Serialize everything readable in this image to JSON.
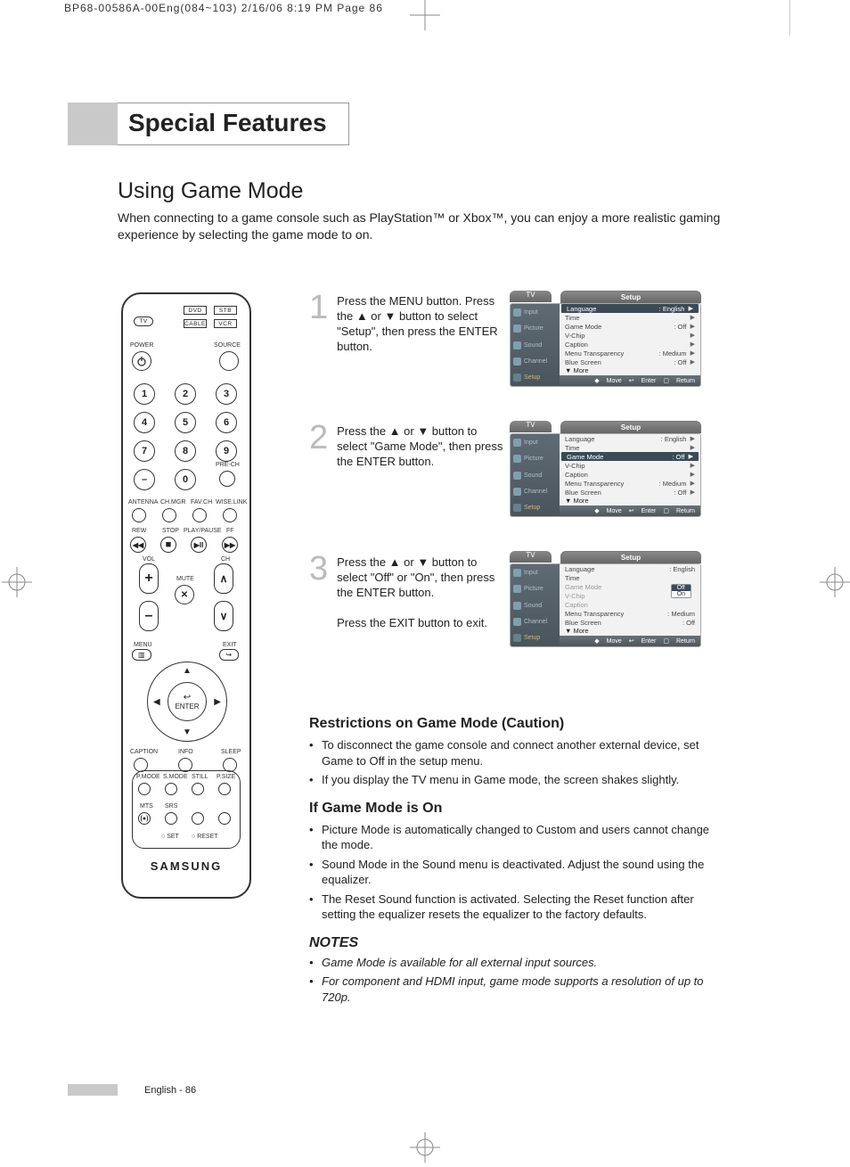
{
  "header_note": "BP68-00586A-00Eng(084~103)  2/16/06  8:19 PM  Page 86",
  "section_title": "Special Features",
  "subheading": "Using Game Mode",
  "intro": "When connecting to a game console such as PlayStation™ or Xbox™, you can enjoy a more realistic gaming experience by selecting the game mode to on.",
  "remote": {
    "tv": "TV",
    "dvd": "DVD",
    "stb": "STB",
    "cable": "CABLE",
    "vcr": "VCR",
    "power": "POWER",
    "source": "SOURCE",
    "nums": [
      "1",
      "2",
      "3",
      "4",
      "5",
      "6",
      "7",
      "8",
      "9",
      "0"
    ],
    "dash": "–",
    "prech": "PRE-CH",
    "ant": "ANTENNA",
    "chmgr": "CH.MGR",
    "favch": "FAV.CH",
    "wiselink": "WISE.LINK",
    "rew": "REW",
    "stop": "STOP",
    "pp": "PLAY/PAUSE",
    "ff": "FF",
    "vol": "VOL",
    "ch": "CH",
    "mute": "MUTE",
    "plus": "+",
    "minus": "–",
    "menu": "MENU",
    "exit": "EXIT",
    "enter": "ENTER",
    "caption": "CAPTION",
    "info": "INFO",
    "sleep": "SLEEP",
    "pmode": "P.MODE",
    "smode": "S.MODE",
    "still": "STILL",
    "psize": "P.SIZE",
    "mts": "MTS",
    "srs": "SRS",
    "set": "SET",
    "reset": "RESET",
    "brand": "SAMSUNG"
  },
  "steps": [
    {
      "num": "1",
      "text": "Press the MENU button. Press the ▲ or ▼ button to select \"Setup\", then press the ENTER button."
    },
    {
      "num": "2",
      "text": "Press the ▲ or ▼ button to select \"Game Mode\", then press the ENTER button."
    },
    {
      "num": "3",
      "text": "Press the ▲ or ▼ button to select \"Off\" or \"On\", then press the ENTER button.",
      "text2": "Press the EXIT button to exit."
    }
  ],
  "osd": {
    "tv": "TV",
    "title": "Setup",
    "left": [
      "Input",
      "Picture",
      "Sound",
      "Channel",
      "Setup"
    ],
    "rows": [
      {
        "k": "Language",
        "v": ": English"
      },
      {
        "k": "Time",
        "v": ""
      },
      {
        "k": "Game Mode",
        "v": ": Off"
      },
      {
        "k": "V-Chip",
        "v": ""
      },
      {
        "k": "Caption",
        "v": ""
      },
      {
        "k": "Menu Transparency",
        "v": ": Medium"
      },
      {
        "k": "Blue Screen",
        "v": ": Off"
      }
    ],
    "more": "▼ More",
    "foot_move": "Move",
    "foot_enter": "Enter",
    "foot_return": "Return",
    "options": [
      "Off",
      "On"
    ]
  },
  "sections": {
    "restrictions_h": "Restrictions on Game Mode (Caution)",
    "restrictions": [
      "To disconnect the game console and connect another external device, set Game to Off in the setup menu.",
      "If you display the TV menu in Game mode, the screen shakes slightly."
    ],
    "if_on_h": "If Game Mode is On",
    "if_on": [
      "Picture Mode is automatically changed to Custom and users  cannot change the mode.",
      "Sound Mode in the Sound menu is deactivated. Adjust the sound using the equalizer.",
      "The Reset Sound function is activated. Selecting the Reset function after setting the equalizer resets the equalizer to the factory defaults."
    ],
    "notes_h": "NOTES",
    "notes": [
      "Game Mode is available for all external input sources.",
      "For component and HDMI input, game mode supports a resolution of up to 720p."
    ]
  },
  "footer": "English - 86"
}
